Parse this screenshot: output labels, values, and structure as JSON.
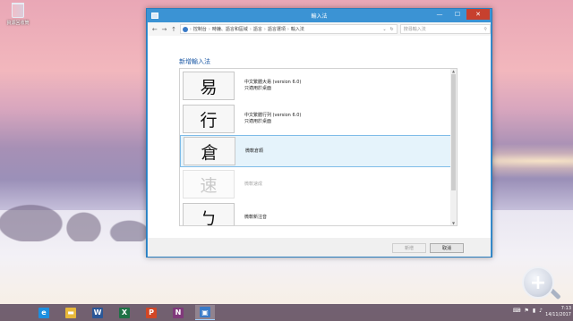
{
  "desktop": {
    "icon_label": "資源回收筒",
    "icon": "recycle-bin-icon"
  },
  "window": {
    "title": "輸入法",
    "controls": {
      "minimize": "—",
      "maximize": "☐",
      "close": "✕"
    }
  },
  "toolbar": {
    "back": "←",
    "forward": "→",
    "up": "↑",
    "breadcrumb": [
      "控制台",
      "時鐘、語言和區域",
      "語言",
      "語言選項",
      "輸入法"
    ],
    "dropdown": "⌄",
    "refresh": "↻",
    "search_placeholder": "搜尋輸入法"
  },
  "main": {
    "heading": "新增輸入法",
    "items": [
      {
        "glyph": "易",
        "line1": "中文繁體大易 (version 6.0)",
        "line2": "只適用於桌面",
        "state": "normal"
      },
      {
        "glyph": "行",
        "line1": "中文繁體行列 (version 6.0)",
        "line2": "只適用於桌面",
        "state": "normal"
      },
      {
        "glyph": "倉",
        "line1": "微軟倉頡",
        "line2": "",
        "state": "selected"
      },
      {
        "glyph": "速",
        "line1": "微軟速成",
        "line2": "",
        "state": "disabled"
      },
      {
        "glyph": "ㄅ",
        "line1": "微軟新注音",
        "line2": "",
        "state": "normal"
      }
    ]
  },
  "footer": {
    "add_label": "新增",
    "cancel_label": "取消"
  },
  "taskbar": {
    "apps": [
      {
        "name": "ie-icon",
        "glyph": "e",
        "color": "#1c8fe0"
      },
      {
        "name": "explorer-icon",
        "glyph": "▬",
        "color": "#e8b83a"
      },
      {
        "name": "word-icon",
        "glyph": "W",
        "color": "#2b5797"
      },
      {
        "name": "excel-icon",
        "glyph": "X",
        "color": "#1e7145"
      },
      {
        "name": "powerpoint-icon",
        "glyph": "P",
        "color": "#d24726"
      },
      {
        "name": "onenote-icon",
        "glyph": "N",
        "color": "#80397b"
      },
      {
        "name": "control-panel-icon",
        "glyph": "▣",
        "color": "#3a7bc8"
      }
    ],
    "tray": [
      "⌨",
      "⚑",
      "▮",
      "♪"
    ],
    "time": "7:13",
    "date": "14/11/2017"
  }
}
